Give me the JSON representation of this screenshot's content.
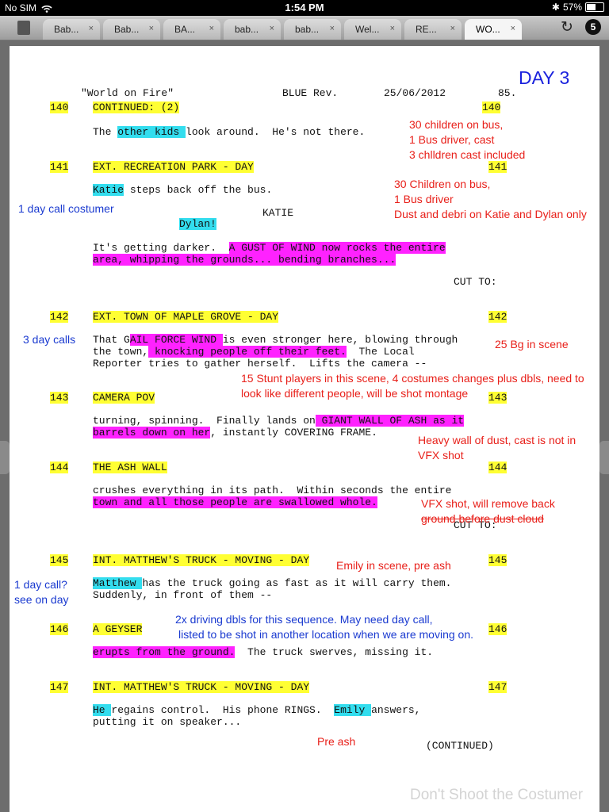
{
  "status_bar": {
    "carrier": "No SIM",
    "time": "1:54 PM",
    "battery": "57%"
  },
  "tabs": [
    {
      "label": "Bab..."
    },
    {
      "label": "Bab..."
    },
    {
      "label": "BA..."
    },
    {
      "label": "bab..."
    },
    {
      "label": "bab..."
    },
    {
      "label": "Wel..."
    },
    {
      "label": "RE..."
    },
    {
      "label": "WO..."
    }
  ],
  "tab_close": "×",
  "toolbar": {
    "settings_badge": "5"
  },
  "script": {
    "day_label": "DAY 3",
    "header": {
      "title": "\"World on Fire\"",
      "revision": "BLUE Rev.",
      "date": "25/06/2012",
      "page": "85."
    },
    "scene_numbers": {
      "s140": "140",
      "s141": "141",
      "s142": "142",
      "s143": "143",
      "s144": "144",
      "s145": "145",
      "s146": "146",
      "s147": "147"
    },
    "headings": {
      "h140": "CONTINUED: (2)",
      "h141": "EXT. RECREATION PARK - DAY",
      "h142": "EXT. TOWN OF MAPLE GROVE - DAY",
      "h143": "CAMERA POV",
      "h144": "THE ASH WALL",
      "h145": "INT. MATTHEW'S TRUCK - MOVING - DAY",
      "h146": "A GEYSER",
      "h147": "INT. MATTHEW'S TRUCK - MOVING - DAY"
    },
    "lines": {
      "l140a_pre": "The ",
      "l140a_hl": "other kids ",
      "l140a_post": "look around.  He's not there.",
      "l141a_hl": "Katie",
      "l141a_post": " steps back off the bus.",
      "character": "KATIE",
      "dialogue": "Dylan!",
      "l141b_pre": "It's getting darker.  ",
      "l141b_hl": "A GUST OF WIND now rocks the entire",
      "l141c_hl": "area, whipping the grounds... bending branches...",
      "cut1": "CUT TO:",
      "l142a_pre": "That G",
      "l142a_hl": "AIL FORCE WIND ",
      "l142a_post": "is even stronger here, blowing through",
      "l142b_pre": "the town,",
      "l142b_hl": " knocking people off their feet.",
      "l142b_post": "  The Local",
      "l142c": "Reporter tries to gather herself.  Lifts the camera --",
      "l143a_pre": "turning, spinning.  Finally lands on",
      "l143a_hl": " GIANT WALL OF ASH as it",
      "l143b_hl": "barrels down on her",
      "l143b_post": ", instantly COVERING FRAME.",
      "l144a": "crushes everything in its path.  Within seconds the entire",
      "l144b_hl": "town and all those people are swallowed whole.",
      "cut2": "CUT TO:",
      "l145a_hl": "Matthew ",
      "l145a_post": "has the truck going as fast as it will carry them.",
      "l145b": "Suddenly, in front of them --",
      "l146a_hl": "erupts from the ground.",
      "l146a_post": "  The truck swerves, missing it.",
      "l147a_hl": "He ",
      "l147a_mid": "regains control.  His phone RINGS.  ",
      "l147a_hl2": "Emily ",
      "l147a_post": "answers,",
      "l147b": "putting it on speaker...",
      "continued": "(CONTINUED)"
    },
    "notes": {
      "n1": "30 children on bus,",
      "n2": "1 Bus driver, cast",
      "n3": "3 chlldren cast included",
      "n4": "30 Children on bus,",
      "n5": "1 Bus driver",
      "n6": "Dust and debri on Katie and Dylan only",
      "n7": "1 day call costumer",
      "n8": "3 day calls",
      "n9": "25 Bg in scene",
      "n10": "15 Stunt players in this scene, 4 costumes changes plus dbls, need to",
      "n11": "look like different people, will be shot montage",
      "n12": "Heavy wall of dust, cast is not in",
      "n13": "VFX shot",
      "n14": "VFX shot, will remove back",
      "n15": "ground before dust cloud",
      "n16": "Emily in scene, pre ash",
      "n17": "1 day call?",
      "n18": "see on day",
      "n19": "2x driving dbls for this sequence.  May need day call,",
      "n20": "listed to be shot in another location when we are moving on.",
      "n21": "Pre ash"
    },
    "watermark": "Don't Shoot the Costumer"
  }
}
